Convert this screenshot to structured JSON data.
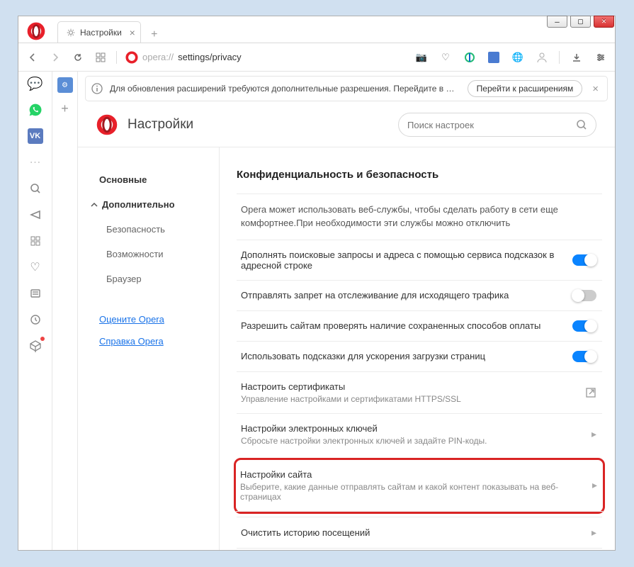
{
  "window": {
    "title_tab": "Настройки",
    "address_prefix": "opera://",
    "address_path": "settings/privacy"
  },
  "info_bar": {
    "text": "Для обновления расширений требуются дополнительные разрешения. Перейдите в менеджер р...",
    "button": "Перейти к расширениям"
  },
  "settings_header": {
    "title": "Настройки",
    "search_placeholder": "Поиск настроек"
  },
  "nav": {
    "basic": "Основные",
    "advanced": "Дополнительно",
    "security": "Безопасность",
    "features": "Возможности",
    "browser": "Браузер",
    "rate": "Оцените Opera",
    "help": "Справка Opera"
  },
  "section": {
    "title": "Конфиденциальность и безопасность",
    "intro": "Opera может использовать веб-службы, чтобы сделать работу в сети еще комфортнее.При необходимости эти службы можно отключить",
    "rows": [
      {
        "label": "Дополнять поисковые запросы и адреса с помощью сервиса подсказок в адресной строке",
        "toggle": true
      },
      {
        "label": "Отправлять запрет на отслеживание для исходящего трафика",
        "toggle": false
      },
      {
        "label": "Разрешить сайтам проверять наличие сохраненных способов оплаты",
        "toggle": true
      },
      {
        "label": "Использовать подсказки для ускорения загрузки страниц",
        "toggle": true
      }
    ],
    "certs": {
      "title": "Настроить сертификаты",
      "sub": "Управление настройками и сертификатами HTTPS/SSL"
    },
    "keys": {
      "title": "Настройки электронных ключей",
      "sub": "Сбросьте настройки электронных ключей и задайте PIN-коды."
    },
    "site": {
      "title": "Настройки сайта",
      "sub": "Выберите, какие данные отправлять сайтам и какой контент показывать на веб-страницах"
    },
    "clear": {
      "title": "Очистить историю посещений"
    }
  }
}
